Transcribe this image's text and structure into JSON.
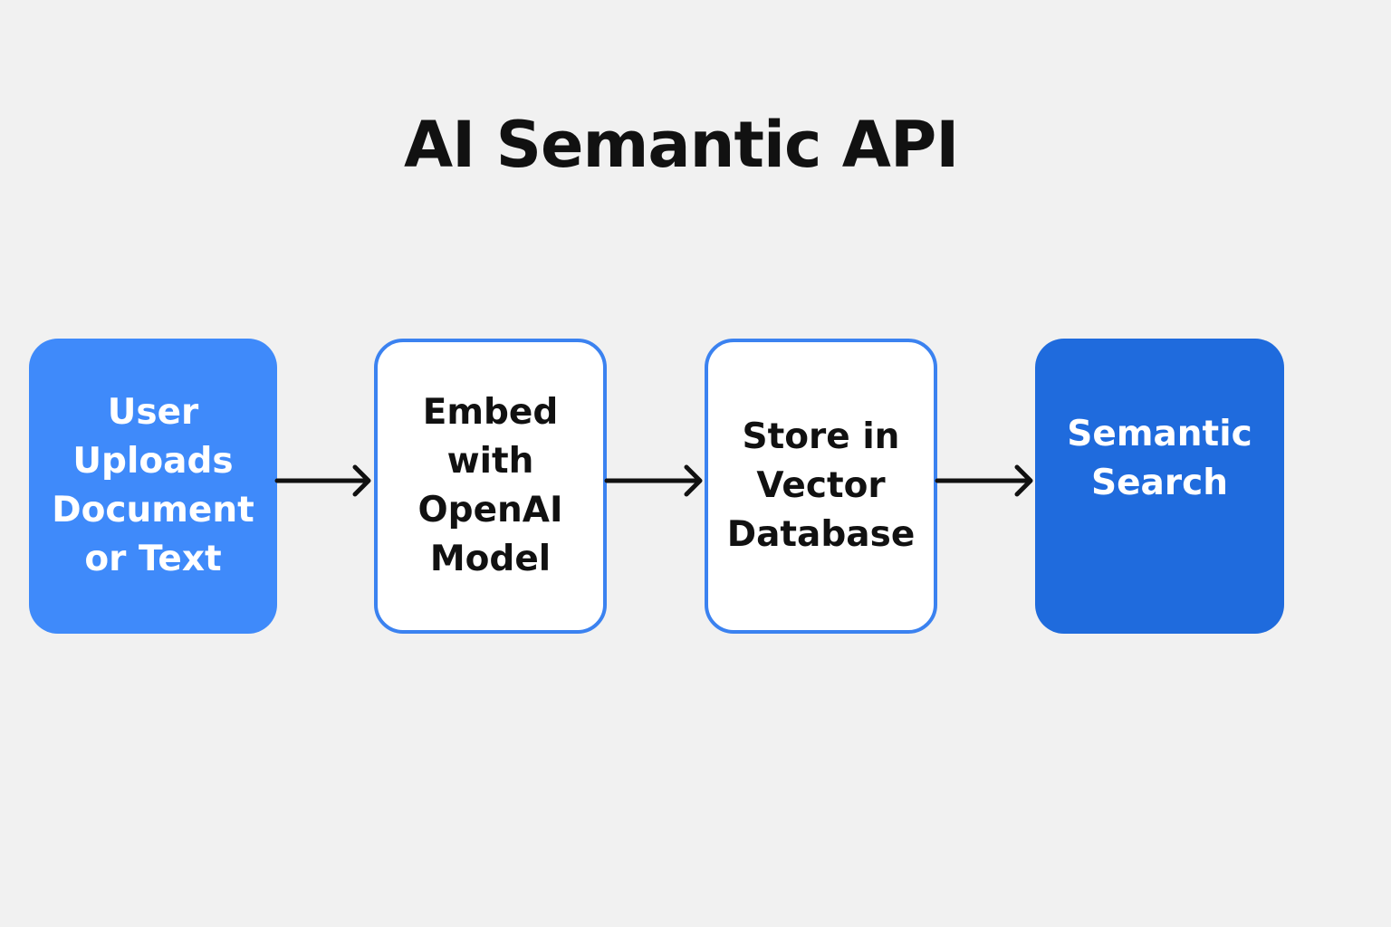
{
  "title": "AI Semantic API",
  "steps": [
    {
      "label": "User\nUploads\nDocument\nor Text"
    },
    {
      "label": "Embed\nwith\nOpenAI\nModel"
    },
    {
      "label": "Store in\nVector\nDatabase"
    },
    {
      "label": "Semantic\nSearch"
    }
  ],
  "colors": {
    "background": "#f1f1f1",
    "step_light_blue": "#3f8afa",
    "step_outline_blue": "#3b82f0",
    "step_dark_blue": "#1f6bdd",
    "arrow": "#111111"
  }
}
